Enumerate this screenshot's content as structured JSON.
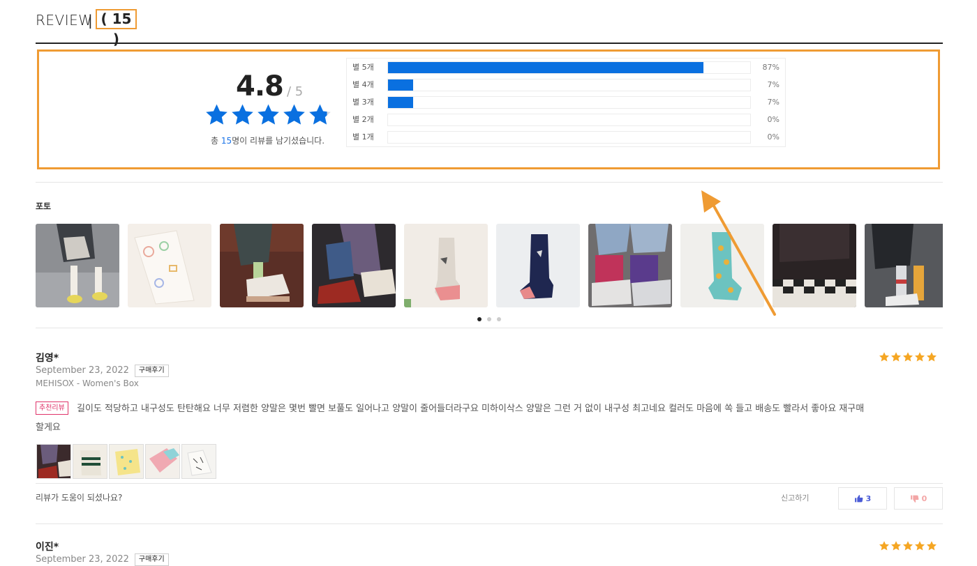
{
  "header": {
    "title": "REVIEW",
    "separator": "|",
    "count": "( 15 )"
  },
  "summary": {
    "score": "4.8",
    "score_max": "/ 5",
    "stars": 5,
    "total_prefix": "총 ",
    "total_count": "15",
    "total_suffix": "명이 리뷰를 남기셨습니다.",
    "distribution": [
      {
        "label": "별 5개",
        "percent": 87,
        "percent_text": "87%"
      },
      {
        "label": "별 4개",
        "percent": 7,
        "percent_text": "7%"
      },
      {
        "label": "별 3개",
        "percent": 7,
        "percent_text": "7%"
      },
      {
        "label": "별 2개",
        "percent": 0,
        "percent_text": "0%"
      },
      {
        "label": "별 1개",
        "percent": 0,
        "percent_text": "0%"
      }
    ]
  },
  "photos": {
    "heading": "포토",
    "count": 10,
    "pages": 3,
    "active_page": 0
  },
  "reviews": [
    {
      "name": "김영*",
      "date": "September 23, 2022",
      "badge": "구매후기",
      "product": "MEHISOX - Women's Box",
      "rating": 5,
      "recommended_badge": "추천리뷰",
      "text_line1": "길이도 적당하고 내구성도 탄탄해요 너무 저렴한 양말은 몇번 빨면 보풀도 일어나고 양말이 줄어들더라구요 미하이삭스 양말은 그런 거 없이 내구성 최고네요 컬러도 마음에 쏙 들고 배송도 빨라서 좋아요 재구매",
      "text_line2": "할게요",
      "thumb_count": 5,
      "helpful_question": "리뷰가 도움이 되셨나요?",
      "report_label": "신고하기",
      "likes": "3",
      "dislikes": "0"
    },
    {
      "name": "이진*",
      "date": "September 23, 2022",
      "badge": "구매후기",
      "rating": 5
    }
  ],
  "colors": {
    "accent_blue": "#0a70e0",
    "star_yellow": "#f5a623",
    "highlight_orange": "#ef9b33",
    "recommend_pink": "#e0336a"
  }
}
